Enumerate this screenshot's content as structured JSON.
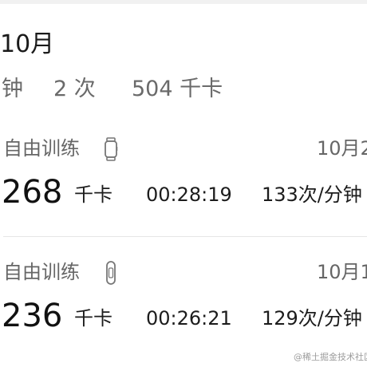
{
  "header": {
    "month": "10月"
  },
  "summary": {
    "duration_unit": "钟",
    "count": "2 次",
    "calories": "504 千卡"
  },
  "records": [
    {
      "type": "自由训练",
      "device_icon": "watch-icon",
      "date": "10月2",
      "calories_value": "268",
      "calories_unit": "千卡",
      "duration": "00:28:19",
      "heart_rate": "133次/分钟"
    },
    {
      "type": "自由训练",
      "device_icon": "band-icon",
      "date": "10月1",
      "calories_value": "236",
      "calories_unit": "千卡",
      "duration": "00:26:21",
      "heart_rate": "129次/分钟"
    }
  ],
  "watermark": "@稀土掘金技术社区"
}
